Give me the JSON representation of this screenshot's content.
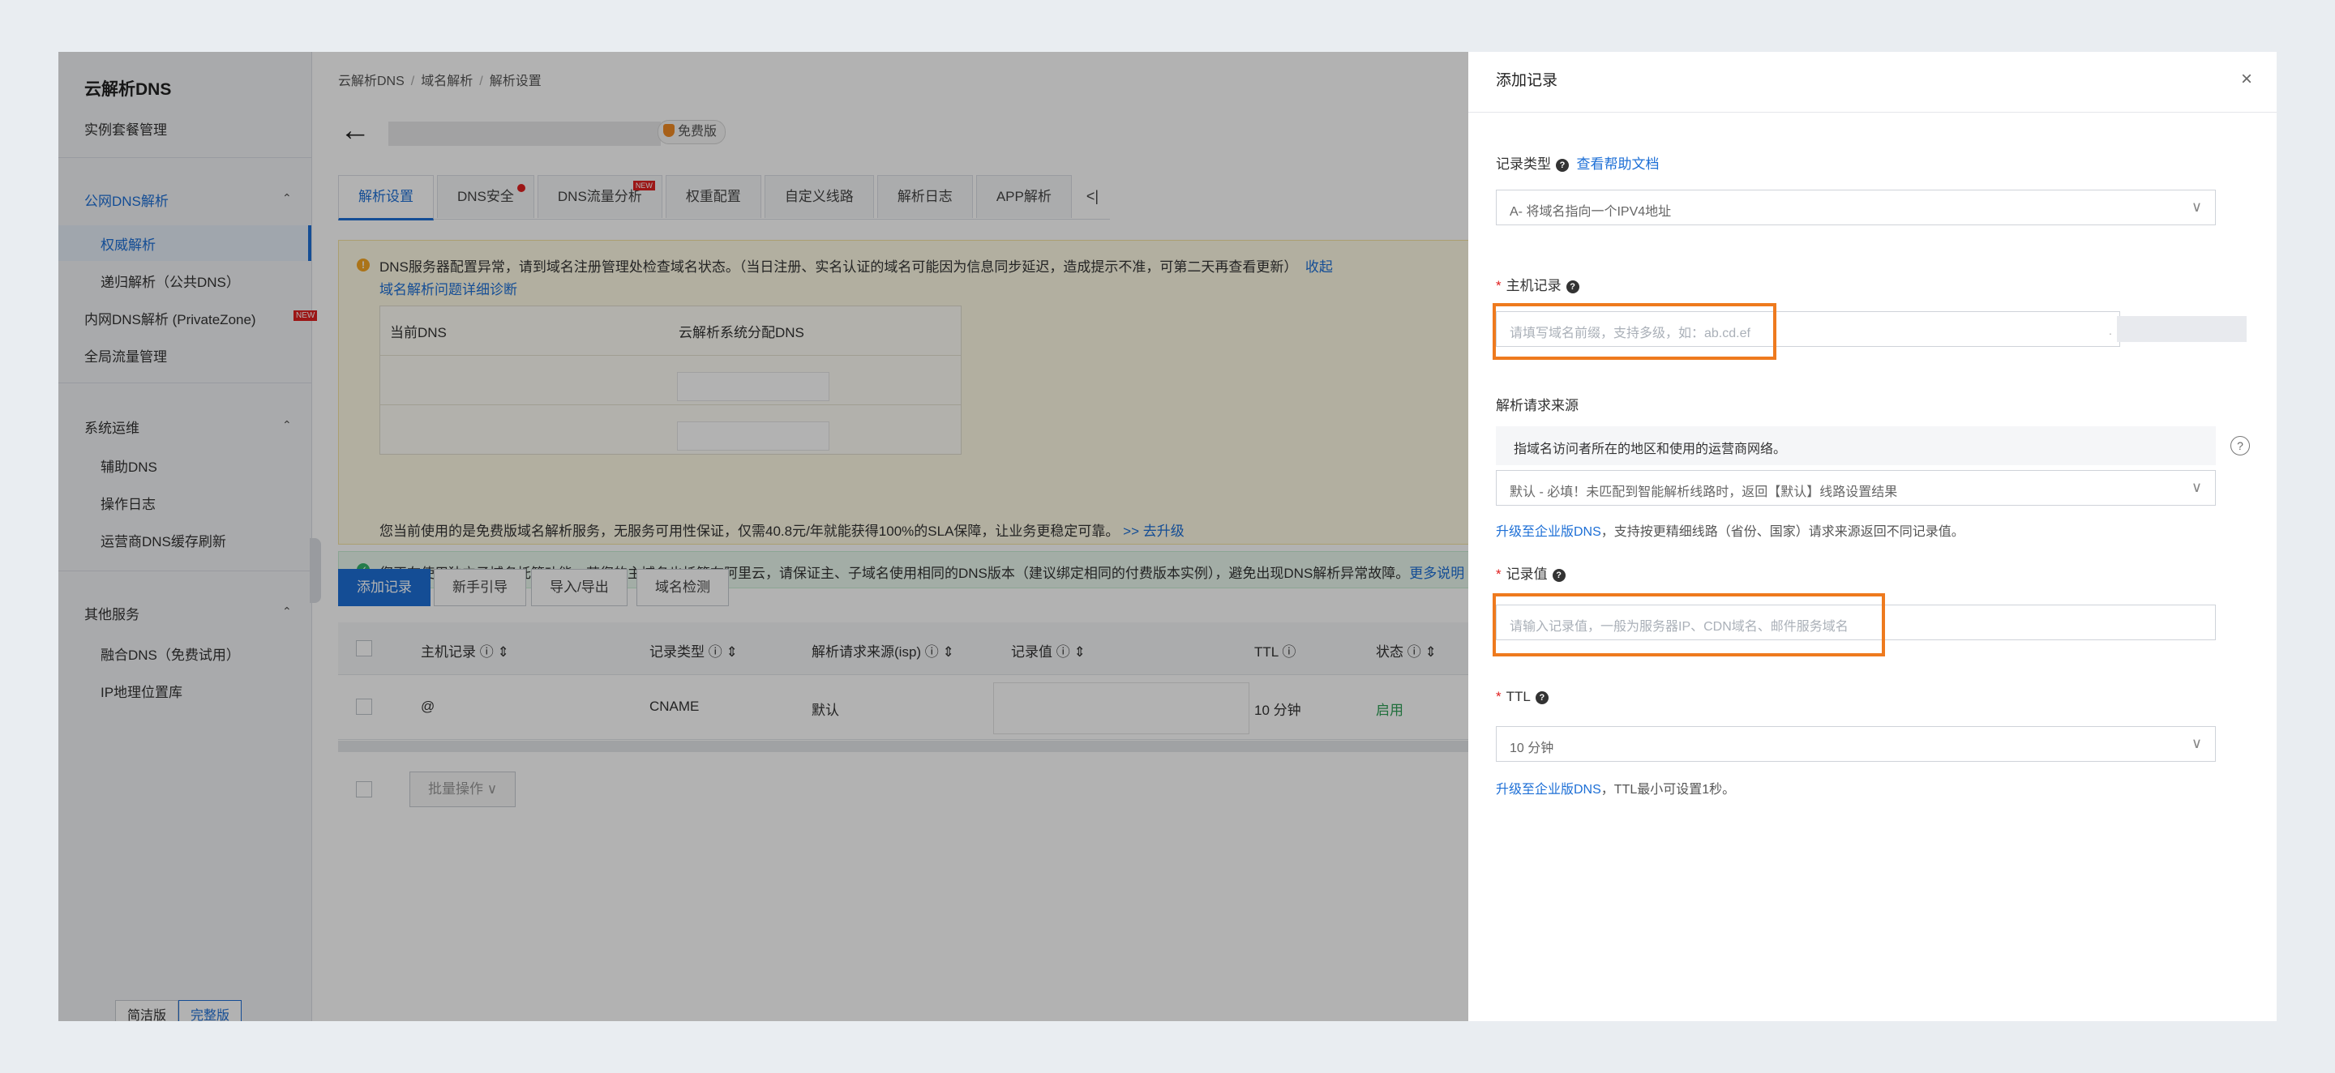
{
  "sidebar": {
    "title": "云解析DNS",
    "items": [
      {
        "label": "实例套餐管理"
      },
      {
        "label": "公网DNS解析"
      },
      {
        "label": "权威解析"
      },
      {
        "label": "递归解析（公共DNS）"
      },
      {
        "label": "内网DNS解析 (PrivateZone)"
      },
      {
        "label": "全局流量管理"
      },
      {
        "label": "系统运维"
      },
      {
        "label": "辅助DNS"
      },
      {
        "label": "操作日志"
      },
      {
        "label": "运营商DNS缓存刷新"
      },
      {
        "label": "其他服务"
      },
      {
        "label": "融合DNS（免费试用）"
      },
      {
        "label": "IP地理位置库"
      }
    ],
    "new_badge": "NEW",
    "mode_simple": "简洁版",
    "mode_full": "完整版"
  },
  "breadcrumb": [
    "云解析DNS",
    "域名解析",
    "解析设置"
  ],
  "header": {
    "badge": "免费版"
  },
  "tabs": [
    {
      "label": "解析设置"
    },
    {
      "label": "DNS安全"
    },
    {
      "label": "DNS流量分析",
      "tag": "NEW"
    },
    {
      "label": "权重配置"
    },
    {
      "label": "自定义线路"
    },
    {
      "label": "解析日志"
    },
    {
      "label": "APP解析"
    }
  ],
  "tab_more": "<|",
  "warning": {
    "text": "DNS服务器配置异常，请到域名注册管理处检查域名状态。（当日注册、实名认证的域名可能因为信息同步延迟，造成提示不准，可第二天再查看更新）",
    "collapse": "收起",
    "diag_link": "域名解析问题详细诊断",
    "col_current": "当前DNS",
    "col_assigned": "云解析系统分配DNS",
    "bottom": "您当前使用的是免费版域名解析服务，无服务可用性保证，仅需40.8元/年就能获得100%的SLA保障，让业务更稳定可靠。",
    "upgrade": ">> 去升级"
  },
  "info": {
    "text": "您正在使用独立子域名托管功能，若您的主域名也托管在阿里云，请保证主、子域名使用相同的DNS版本（建议绑定相同的付费版本实例），避免出现DNS解析异常故障。",
    "more": "更多说明"
  },
  "actions": {
    "add": "添加记录",
    "guide": "新手引导",
    "import": "导入/导出",
    "check": "域名检测"
  },
  "table": {
    "headers": [
      "主机记录 ⓘ ⇕",
      "记录类型 ⓘ ⇕",
      "解析请求来源(isp) ⓘ ⇕",
      "记录值 ⓘ ⇕",
      "TTL ⓘ",
      "状态 ⓘ ⇕"
    ],
    "rows": [
      {
        "host": "@",
        "type": "CNAME",
        "isp": "默认",
        "ttl": "10 分钟",
        "status": "启用"
      }
    ],
    "bulk": "批量操作 ∨"
  },
  "drawer": {
    "title": "添加记录",
    "close": "×",
    "record_type_label": "记录类型",
    "help_doc": "查看帮助文档",
    "record_type_value": "A- 将域名指向一个IPV4地址",
    "host_label": "主机记录",
    "host_placeholder": "请填写域名前缀，支持多级，如：ab.cd.ef",
    "source_label": "解析请求来源",
    "source_hint": "指域名访问者所在的地区和使用的运营商网络。",
    "source_value": "默认 - 必填！未匹配到智能解析线路时，返回【默认】线路设置结果",
    "upgrade_link": "升级至企业版DNS",
    "upgrade_note": "，支持按更精细线路（省份、国家）请求来源返回不同记录值。",
    "value_label": "记录值",
    "value_placeholder": "请输入记录值，一般为服务器IP、CDN域名、邮件服务域名",
    "ttl_label": "TTL",
    "ttl_value": "10 分钟",
    "ttl_upgrade_link": "升级至企业版DNS",
    "ttl_note": "，TTL最小可设置1秒。"
  },
  "colors": {
    "accent": "#1d6fd6",
    "highlight": "#ee7a1e",
    "required": "#e02020"
  }
}
